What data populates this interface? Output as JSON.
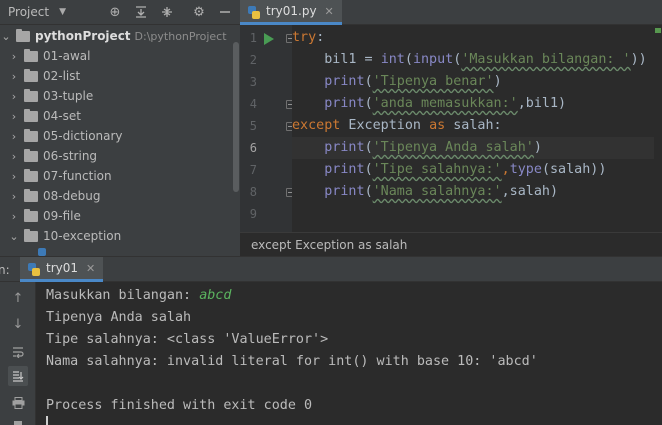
{
  "project_panel": {
    "title": "Project",
    "tree": [
      {
        "label": "pythonProject",
        "path": "D:\\pythonProject",
        "expanded": true,
        "root": true
      },
      {
        "label": "01-awal"
      },
      {
        "label": "02-list"
      },
      {
        "label": "03-tuple"
      },
      {
        "label": "04-set"
      },
      {
        "label": "05-dictionary"
      },
      {
        "label": "06-string"
      },
      {
        "label": "07-function"
      },
      {
        "label": "08-debug"
      },
      {
        "label": "09-file"
      },
      {
        "label": "10-exception",
        "expanded": true
      }
    ]
  },
  "editor": {
    "tab": {
      "label": "try01.py"
    },
    "lines": [
      {
        "num": "1"
      },
      {
        "num": "2"
      },
      {
        "num": "3"
      },
      {
        "num": "4"
      },
      {
        "num": "5"
      },
      {
        "num": "6"
      },
      {
        "num": "7"
      },
      {
        "num": "8"
      },
      {
        "num": "9"
      }
    ],
    "code": {
      "l1": {
        "kw": "try",
        "rest": ":"
      },
      "l2": {
        "a": "bil1 = ",
        "fn1": "int",
        "b": "(",
        "fn2": "input",
        "c": "(",
        "str": "'Masukkan bilangan: '",
        "d": "))"
      },
      "l3": {
        "fn": "print",
        "a": "(",
        "str": "'Tipenya benar'",
        "b": ")"
      },
      "l4": {
        "fn": "print",
        "a": "(",
        "str": "'anda memasukkan:'",
        "b": ",bil1)"
      },
      "l5": {
        "kw1": "except",
        "a": " Exception ",
        "kw2": "as",
        "b": " salah:"
      },
      "l6": {
        "fn": "print",
        "a": "(",
        "str": "'Tipenya Anda salah'",
        "b": ")"
      },
      "l7": {
        "fn": "print",
        "a": "(",
        "str": "'Tipe salahnya:'",
        "b": ",",
        "fn2": "type",
        "c": "(salah))"
      },
      "l8": {
        "fn": "print",
        "a": "(",
        "str": "'Nama salahnya:'",
        "b": ",salah)"
      }
    },
    "breadcrumb": "except Exception as salah"
  },
  "run_panel": {
    "label": "n:",
    "tab": {
      "label": "try01"
    },
    "output": {
      "prompt": "Masukkan bilangan: ",
      "input_value": "abcd",
      "line2": "Tipenya Anda salah",
      "line3": "Tipe salahnya: <class 'ValueError'>",
      "line4": "Nama salahnya: invalid literal for int() with base 10: 'abcd'",
      "line6": "Process finished with exit code 0"
    }
  },
  "colors": {
    "accent": "#4a88c7",
    "keyword": "#cc7832",
    "string": "#6a8759",
    "builtin": "#8888c6",
    "run_green": "#499c54",
    "input_green": "#5bb35f"
  },
  "icons": [
    "chevron-down-icon",
    "crosshair-icon",
    "expand-all-icon",
    "collapse-all-icon",
    "gear-icon",
    "minimize-icon",
    "run-icon",
    "python-file-icon",
    "close-icon",
    "arrow-up-icon",
    "arrow-down-icon",
    "soft-wrap-icon",
    "scroll-to-end-icon",
    "print-icon",
    "delete-icon"
  ]
}
